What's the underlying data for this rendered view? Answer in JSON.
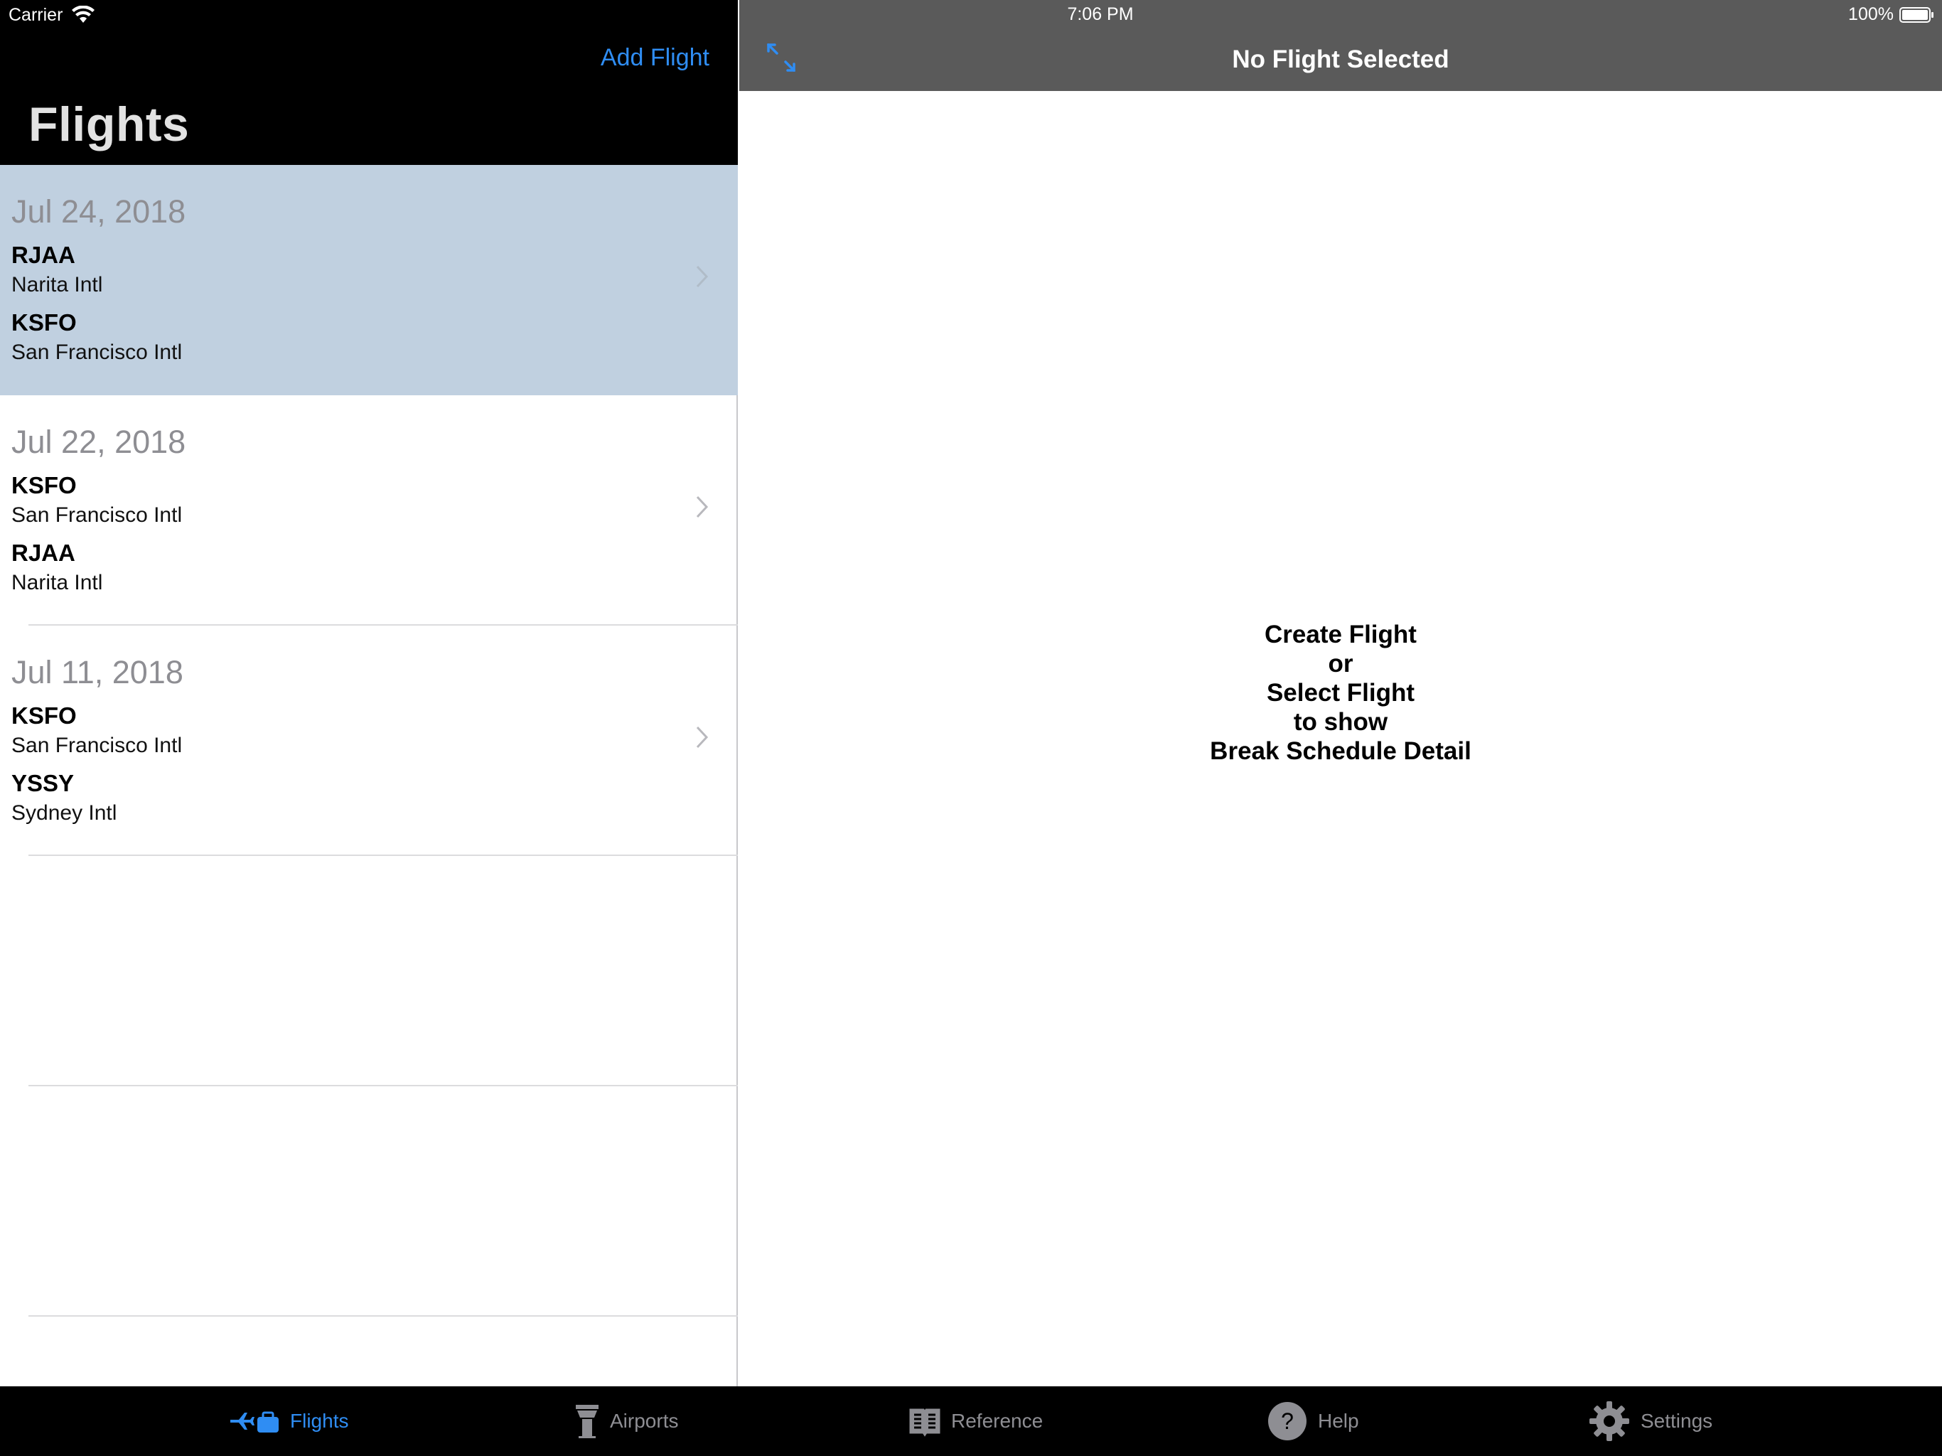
{
  "status_bar": {
    "carrier": "Carrier",
    "time": "7:06 PM",
    "battery": "100%"
  },
  "master": {
    "add_flight_label": "Add Flight",
    "title": "Flights",
    "flights": [
      {
        "date": "Jul 24, 2018",
        "from_code": "RJAA",
        "from_name": "Narita Intl",
        "to_code": "KSFO",
        "to_name": "San Francisco Intl",
        "selected": true
      },
      {
        "date": "Jul 22, 2018",
        "from_code": "KSFO",
        "from_name": "San Francisco Intl",
        "to_code": "RJAA",
        "to_name": "Narita Intl",
        "selected": false
      },
      {
        "date": "Jul 11, 2018",
        "from_code": "KSFO",
        "from_name": "San Francisco Intl",
        "to_code": "YSSY",
        "to_name": "Sydney Intl",
        "selected": false
      }
    ]
  },
  "detail": {
    "title": "No Flight Selected",
    "placeholder_lines": [
      "Create Flight",
      "or",
      "Select Flight",
      "to show",
      "Break Schedule Detail"
    ]
  },
  "tab_bar": {
    "items": [
      {
        "label": "Flights",
        "icon": "flights-icon",
        "active": true
      },
      {
        "label": "Airports",
        "icon": "control-tower-icon",
        "active": false
      },
      {
        "label": "Reference",
        "icon": "book-icon",
        "active": false
      },
      {
        "label": "Help",
        "icon": "help-icon",
        "active": false
      },
      {
        "label": "Settings",
        "icon": "gear-icon",
        "active": false
      }
    ]
  },
  "colors": {
    "accent": "#2f8df3",
    "selected_row": "#c0d0e0",
    "detail_header": "#5a5a5a",
    "inactive_tab": "#8e8e93"
  }
}
